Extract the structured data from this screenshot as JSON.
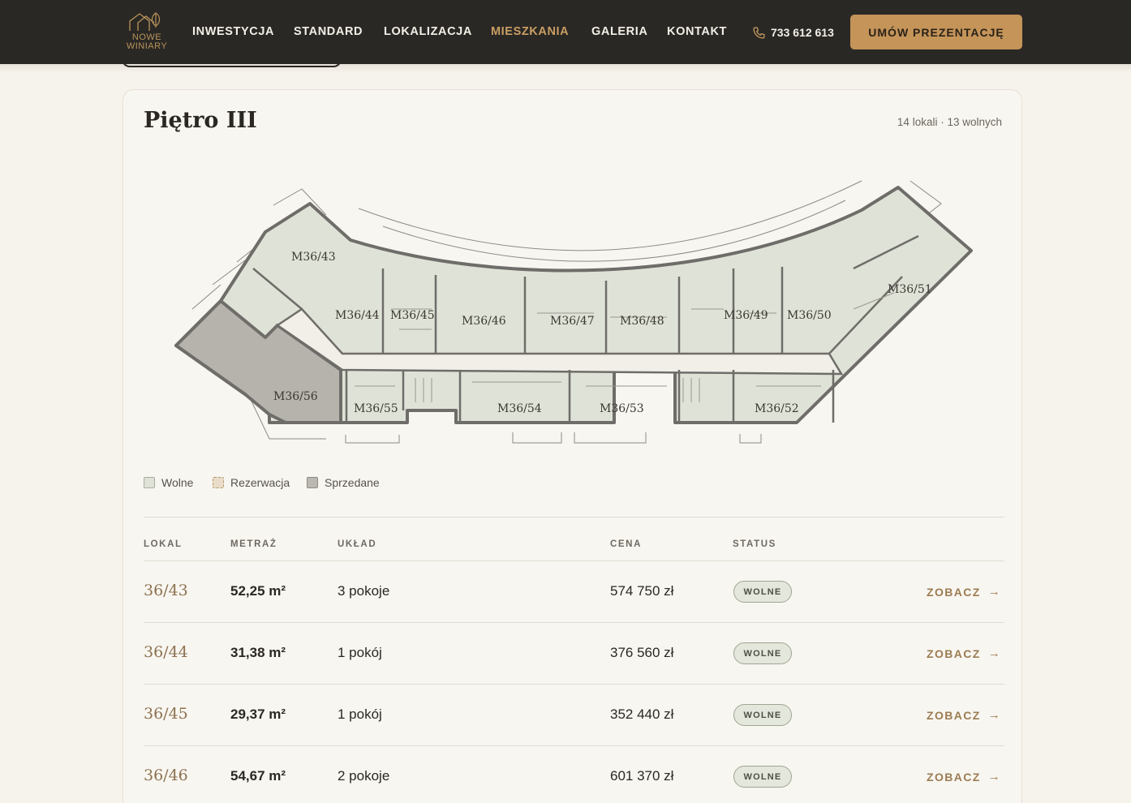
{
  "header": {
    "logo_line1": "NOWE",
    "logo_line2": "WINIARY",
    "nav": [
      {
        "label": "INWESTYCJA",
        "active": false
      },
      {
        "label": "STANDARD",
        "active": false
      },
      {
        "label": "LOKALIZACJA",
        "active": false
      },
      {
        "label": "MIESZKANIA",
        "active": true
      },
      {
        "label": "GALERIA",
        "active": false
      },
      {
        "label": "KONTAKT",
        "active": false
      }
    ],
    "phone_icon": "phone-icon",
    "phone": "733 612 613",
    "cta": "UMÓW PREZENTACJĘ"
  },
  "floor": {
    "title": "Piętro III",
    "count": "14 lokali · 13 wolnych",
    "plan_labels": [
      "M36/43",
      "M36/44",
      "M36/45",
      "M36/46",
      "M36/47",
      "M36/48",
      "M36/49",
      "M36/50",
      "M36/51",
      "M36/52",
      "M36/53",
      "M36/54",
      "M36/55",
      "M36/56"
    ],
    "sold_unit": "M36/56"
  },
  "legend": [
    {
      "label": "Wolne",
      "kind": "free"
    },
    {
      "label": "Rezerwacja",
      "kind": "res"
    },
    {
      "label": "Sprzedane",
      "kind": "sold"
    }
  ],
  "table": {
    "headers": [
      "LOKAL",
      "METRAŻ",
      "UKŁAD",
      "CENA",
      "STATUS"
    ],
    "rows": [
      {
        "lokal": "36/43",
        "area": "52,25 m²",
        "layout": "3 pokoje",
        "price": "574 750 zł",
        "status": "WOLNE",
        "action": "ZOBACZ"
      },
      {
        "lokal": "36/44",
        "area": "31,38 m²",
        "layout": "1 pokój",
        "price": "376 560 zł",
        "status": "WOLNE",
        "action": "ZOBACZ"
      },
      {
        "lokal": "36/45",
        "area": "29,37 m²",
        "layout": "1 pokój",
        "price": "352 440 zł",
        "status": "WOLNE",
        "action": "ZOBACZ"
      },
      {
        "lokal": "36/46",
        "area": "54,67 m²",
        "layout": "2 pokoje",
        "price": "601 370 zł",
        "status": "WOLNE",
        "action": "ZOBACZ"
      }
    ]
  },
  "colors": {
    "header_bg": "#2a2825",
    "accent": "#c49459",
    "page_bg": "#f6f3ec",
    "unit_free": "#dfe3d7",
    "unit_sold": "#b6b3ad",
    "wall": "#6f6d69"
  }
}
